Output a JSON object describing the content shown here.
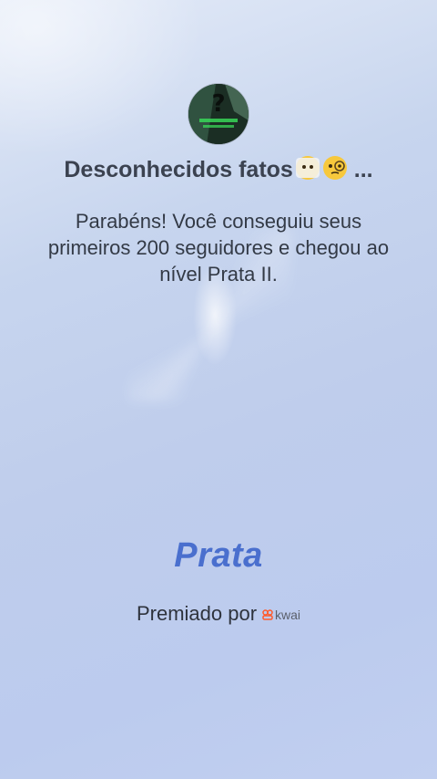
{
  "creator": {
    "avatar_icon": "question-mark-avatar-icon",
    "name": "Desconhecidos fatos",
    "name_emojis": [
      "peeking-face-emoji",
      "monocle-face-emoji"
    ],
    "ellipsis": "..."
  },
  "message": {
    "text": "Parabéns! Você conseguiu seus primeiros 200 seguidores e chegou ao nível Prata II."
  },
  "level": {
    "title": "Prata",
    "color": "#4a6fce"
  },
  "awarded_by": {
    "label": "Premiado por",
    "brand": "kwai",
    "brand_icon": "kwai-logo-icon",
    "brand_color": "#ff5a2b"
  }
}
